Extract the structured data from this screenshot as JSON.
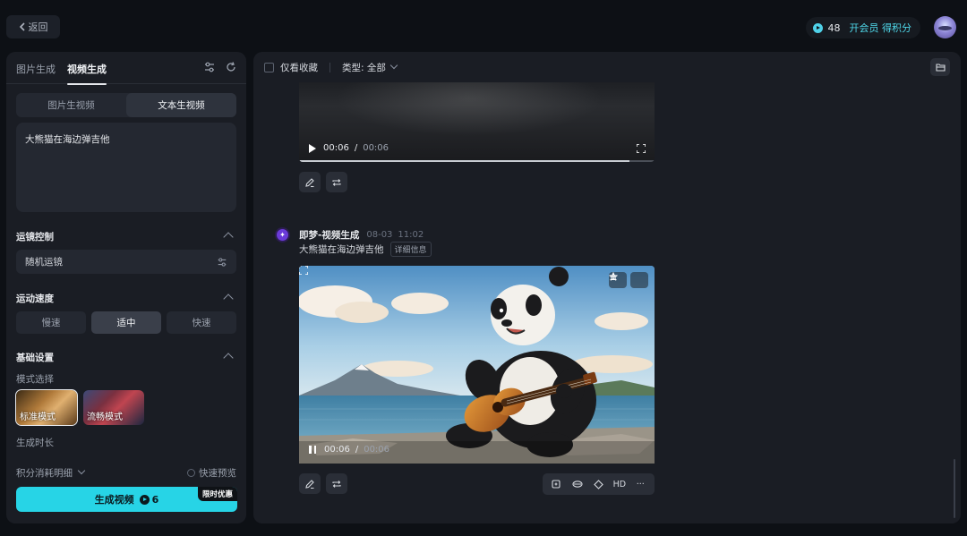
{
  "header": {
    "back_label": "返回",
    "credits": "48",
    "vip_label": "开会员 得积分"
  },
  "left": {
    "tabs": [
      {
        "label": "图片生成",
        "active": false
      },
      {
        "label": "视频生成",
        "active": true
      }
    ],
    "mode_seg": [
      {
        "label": "图片生视频",
        "active": false
      },
      {
        "label": "文本生视频",
        "active": true
      }
    ],
    "prompt_text": "大熊猫在海边弹吉他",
    "camera": {
      "title": "运镜控制",
      "value": "随机运镜"
    },
    "speed": {
      "title": "运动速度",
      "options": [
        {
          "label": "慢速",
          "active": false
        },
        {
          "label": "适中",
          "active": true
        },
        {
          "label": "快速",
          "active": false
        }
      ]
    },
    "basic": {
      "title": "基础设置",
      "mode_label": "模式选择",
      "modes": [
        {
          "label": "标准模式",
          "selected": true
        },
        {
          "label": "流畅模式",
          "selected": false
        }
      ],
      "duration_label": "生成时长"
    },
    "points_detail": "积分消耗明细",
    "fast_preview": "快速预览",
    "generate": {
      "label": "生成视频",
      "cost": "6",
      "badge": "限时优惠"
    }
  },
  "right": {
    "filter": {
      "favorites_only": "仅看收藏",
      "type_label": "类型: 全部"
    },
    "video1": {
      "current": "00:06",
      "sep": "/",
      "duration": "00:06",
      "progress": 0.93,
      "state": "paused"
    },
    "generation": {
      "name": "即梦-视频生成",
      "date": "08-03",
      "time": "11:02",
      "prompt": "大熊猫在海边弹吉他",
      "detail_tag": "详细信息"
    },
    "video2": {
      "current": "00:06",
      "sep": "/",
      "duration": "00:06",
      "state": "playing"
    },
    "toolbar": {
      "hd_label": "HD",
      "more_label": "···"
    }
  },
  "icons": {
    "back": "chevron-left-icon",
    "settings": "sliders-icon",
    "refresh": "refresh-icon",
    "folder": "folder-icon",
    "edit": "pencil-icon",
    "regenerate": "repeat-icon",
    "download": "download-icon",
    "favorite": "star-icon",
    "fullscreen": "fullscreen-icon"
  },
  "colors": {
    "accent": "#27d4e6",
    "panel": "#1a1d24",
    "background": "#0d1015"
  }
}
